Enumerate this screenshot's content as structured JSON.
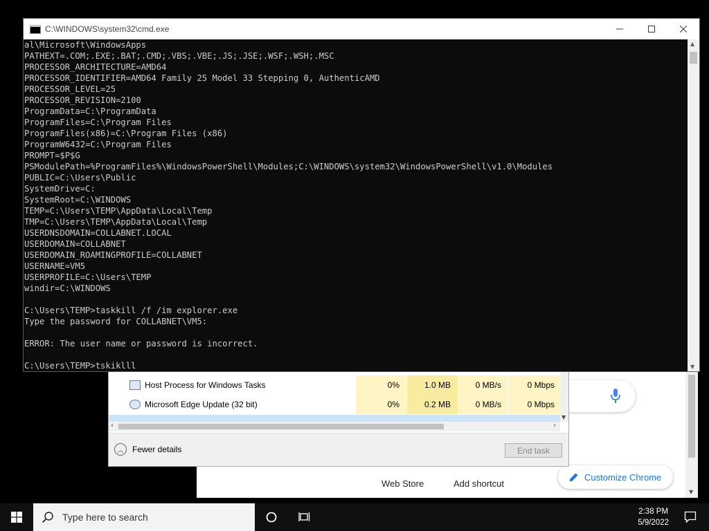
{
  "cmd": {
    "title": "C:\\WINDOWS\\system32\\cmd.exe",
    "lines": [
      "al\\Microsoft\\WindowsApps",
      "PATHEXT=.COM;.EXE;.BAT;.CMD;.VBS;.VBE;.JS;.JSE;.WSF;.WSH;.MSC",
      "PROCESSOR_ARCHITECTURE=AMD64",
      "PROCESSOR_IDENTIFIER=AMD64 Family 25 Model 33 Stepping 0, AuthenticAMD",
      "PROCESSOR_LEVEL=25",
      "PROCESSOR_REVISION=2100",
      "ProgramData=C:\\ProgramData",
      "ProgramFiles=C:\\Program Files",
      "ProgramFiles(x86)=C:\\Program Files (x86)",
      "ProgramW6432=C:\\Program Files",
      "PROMPT=$P$G",
      "PSModulePath=%ProgramFiles%\\WindowsPowerShell\\Modules;C:\\WINDOWS\\system32\\WindowsPowerShell\\v1.0\\Modules",
      "PUBLIC=C:\\Users\\Public",
      "SystemDrive=C:",
      "SystemRoot=C:\\WINDOWS",
      "TEMP=C:\\Users\\TEMP\\AppData\\Local\\Temp",
      "TMP=C:\\Users\\TEMP\\AppData\\Local\\Temp",
      "USERDNSDOMAIN=COLLABNET.LOCAL",
      "USERDOMAIN=COLLABNET",
      "USERDOMAIN_ROAMINGPROFILE=COLLABNET",
      "USERNAME=VM5",
      "USERPROFILE=C:\\Users\\TEMP",
      "windir=C:\\WINDOWS",
      "",
      "C:\\Users\\TEMP>taskkill /f /im explorer.exe",
      "Type the password for COLLABNET\\VM5:",
      "",
      "ERROR: The user name or password is incorrect.",
      "",
      "C:\\Users\\TEMP>tskiklll"
    ]
  },
  "task_manager": {
    "rows": [
      {
        "name": "Host Process for Windows Tasks",
        "cpu": "0%",
        "memory": "1.0 MB",
        "disk": "0 MB/s",
        "network": "0 Mbps"
      },
      {
        "name": "Microsoft Edge Update (32 bit)",
        "cpu": "0%",
        "memory": "0.2 MB",
        "disk": "0 MB/s",
        "network": "0 Mbps"
      }
    ],
    "fewer_details_label": "Fewer details",
    "end_task_label": "End task"
  },
  "chrome": {
    "web_store_label": "Web Store",
    "add_shortcut_label": "Add shortcut",
    "customize_label": "Customize Chrome",
    "accent_color": "#1a73e8"
  },
  "taskbar": {
    "search_placeholder": "Type here to search",
    "time": "2:38 PM",
    "date": "5/9/2022"
  }
}
